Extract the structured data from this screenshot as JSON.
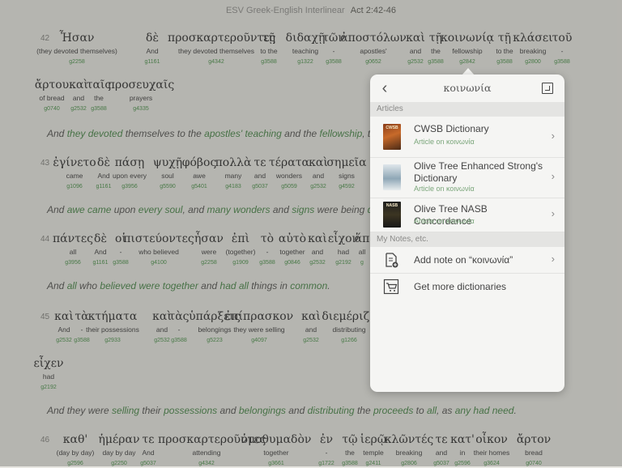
{
  "titlebar": {
    "name": "ESV Greek-English Interlinear",
    "ref": "Act 2:42-46"
  },
  "verses": [
    {
      "num": "42",
      "words": [
        [
          "Ἦσαν",
          "(they devoted themselves)",
          "g2258"
        ],
        [
          "δὲ",
          "And",
          "g1161"
        ],
        [
          "προσκαρτεροῦντες",
          "they devoted themselves",
          "g4342"
        ],
        [
          "τῇ",
          "to the",
          "g3588"
        ],
        [
          "διδαχῇ",
          "teaching",
          "g1322"
        ],
        [
          "τῶν",
          "-",
          "g3588"
        ],
        [
          "ἀποστόλων",
          "apostles'",
          "g0652"
        ],
        [
          "καὶ",
          "and",
          "g2532"
        ],
        [
          "τῇ",
          "the",
          "g3588"
        ],
        [
          "κοινωνίᾳ",
          "fellowship",
          "g2842"
        ],
        [
          "τῇ",
          "to the",
          "g3588"
        ],
        [
          "κλάσει",
          "breaking",
          "g2800"
        ],
        [
          "τοῦ",
          "-",
          "g3588"
        ]
      ],
      "words2": [
        [
          "ἄρτου",
          "of bread",
          "g0740"
        ],
        [
          "καὶ",
          "and",
          "g2532"
        ],
        [
          "ταῖς",
          "the",
          "g3588"
        ],
        [
          "προσευχαῖς",
          "prayers",
          "g4335"
        ]
      ],
      "translation": [
        [
          "And ",
          "n"
        ],
        [
          "they ",
          "h"
        ],
        [
          "devoted ",
          "h"
        ],
        [
          "themselves to the ",
          "n"
        ],
        [
          "apostles' teaching ",
          "h"
        ],
        [
          "and the ",
          "n"
        ],
        [
          "fellowship",
          "h"
        ],
        [
          ", to t",
          "n"
        ]
      ]
    },
    {
      "num": "43",
      "words": [
        [
          "ἐγίνετο",
          "came",
          "g1096"
        ],
        [
          "δὲ",
          "And",
          "g1161"
        ],
        [
          "πάσῃ",
          "upon every",
          "g3956"
        ],
        [
          "ψυχῇ",
          "soul",
          "g5590"
        ],
        [
          "φόβος",
          "awe",
          "g5401"
        ],
        [
          "πολλὰ",
          "many",
          "g4183"
        ],
        [
          "τε",
          "and",
          "g5037"
        ],
        [
          "τέρατα",
          "wonders",
          "g5059"
        ],
        [
          "καὶ",
          "and",
          "g2532"
        ],
        [
          "σημεῖα",
          "signs",
          "g4592"
        ]
      ],
      "translation": [
        [
          "And ",
          "n"
        ],
        [
          "awe ",
          "h"
        ],
        [
          "came ",
          "h"
        ],
        [
          "upon ",
          "n"
        ],
        [
          "every soul",
          "h"
        ],
        [
          ", and ",
          "n"
        ],
        [
          "many wonders ",
          "h"
        ],
        [
          "and ",
          "n"
        ],
        [
          "signs ",
          "h"
        ],
        [
          "were being ",
          "n"
        ],
        [
          "done",
          "h"
        ]
      ]
    },
    {
      "num": "44",
      "words": [
        [
          "πάντες",
          "all",
          "g3956"
        ],
        [
          "δὲ",
          "And",
          "g1161"
        ],
        [
          "οἱ",
          "-",
          "g3588"
        ],
        [
          "πιστεύοντες",
          "who believed",
          "g4100"
        ],
        [
          "ἦσαν",
          "were",
          "g2258"
        ],
        [
          "ἐπὶ",
          "(together)",
          "g1909"
        ],
        [
          "τὸ",
          "-",
          "g3588"
        ],
        [
          "αὐτὸ",
          "together",
          "g0846"
        ],
        [
          "καὶ",
          "and",
          "g2532"
        ],
        [
          "εἶχον",
          "had",
          "g2192"
        ],
        [
          "ἅπ",
          "all",
          "g"
        ]
      ],
      "translation": [
        [
          "And ",
          "n"
        ],
        [
          "all ",
          "h"
        ],
        [
          "who ",
          "n"
        ],
        [
          "believed ",
          "h"
        ],
        [
          "were together ",
          "h"
        ],
        [
          "and ",
          "n"
        ],
        [
          "had ",
          "h"
        ],
        [
          "all ",
          "h"
        ],
        [
          "things in ",
          "n"
        ],
        [
          "common",
          "h"
        ],
        [
          ".",
          "n"
        ]
      ]
    },
    {
      "num": "45",
      "words": [
        [
          "καὶ",
          "And",
          "g2532"
        ],
        [
          "τὰ",
          "-",
          "g3588"
        ],
        [
          "κτήματα",
          "their possessions",
          "g2933"
        ],
        [
          "καὶ",
          "and",
          "g2532"
        ],
        [
          "τὰς",
          "-",
          "g3588"
        ],
        [
          "ὑπάρξεις",
          "belongings",
          "g5223"
        ],
        [
          "ἐπίπρασκον",
          "they were selling",
          "g4097"
        ],
        [
          "καὶ",
          "and",
          "g2532"
        ],
        [
          "διεμέριζο",
          "distributing",
          "g1266"
        ]
      ],
      "words2": [
        [
          "εἶχεν",
          "had",
          "g2192"
        ]
      ],
      "translation": [
        [
          "And ",
          "n"
        ],
        [
          "they were ",
          "n"
        ],
        [
          "selling ",
          "h"
        ],
        [
          "their ",
          "n"
        ],
        [
          "possessions ",
          "h"
        ],
        [
          "and ",
          "n"
        ],
        [
          "belongings ",
          "h"
        ],
        [
          "and ",
          "n"
        ],
        [
          "distributing ",
          "h"
        ],
        [
          "the ",
          "n"
        ],
        [
          "proceeds ",
          "h"
        ],
        [
          "to ",
          "n"
        ],
        [
          "all",
          "h"
        ],
        [
          ", as ",
          "n"
        ],
        [
          "any ",
          "h"
        ],
        [
          "had need",
          "h"
        ],
        [
          ".",
          "n"
        ]
      ]
    },
    {
      "num": "46",
      "words": [
        [
          "καθ'",
          "(day by day)",
          "g2596"
        ],
        [
          "ἡμέραν",
          "day by day",
          "g2250"
        ],
        [
          "τε",
          "And",
          "g5037"
        ],
        [
          "προσκαρτεροῦντες",
          "attending",
          "g4342"
        ],
        [
          "ὁμοθυμαδὸν",
          "together",
          "g3661"
        ],
        [
          "ἐν",
          "-",
          "g1722"
        ],
        [
          "τῷ",
          "the",
          "g3588"
        ],
        [
          "ἱερῷ",
          "temple",
          "g2411"
        ],
        [
          "κλῶντές",
          "breaking",
          "g2806"
        ],
        [
          "τε",
          "and",
          "g5037"
        ],
        [
          "κατ'",
          "in",
          "g2596"
        ],
        [
          "οἶκον",
          "their homes",
          "g3624"
        ],
        [
          "ἄρτον",
          "bread",
          "g0740"
        ]
      ]
    }
  ],
  "popover": {
    "title": "κοινωνία",
    "back_icon": "back-chevron-icon",
    "open_icon": "open-external-icon",
    "articles_header": "Articles",
    "items": [
      {
        "title": "CWSB Dictionary",
        "subtitle": "Article on κοινωνία",
        "cover": "CWSB"
      },
      {
        "title": "Olive Tree Enhanced Strong's Dictionary",
        "subtitle": "Article on κοινωνία",
        "cover": ""
      },
      {
        "title": "Olive Tree NASB Concordance",
        "subtitle": "Article on κοινωνία",
        "cover": "NASB"
      }
    ],
    "notes_header": "My Notes, etc.",
    "add_note": "Add note on “κοινωνία”",
    "get_more": "Get more dictionaries"
  },
  "colors": {
    "strongs": "#3e8a3e",
    "highlight": "#3d7f3d",
    "bg": "#e7e6e1"
  }
}
